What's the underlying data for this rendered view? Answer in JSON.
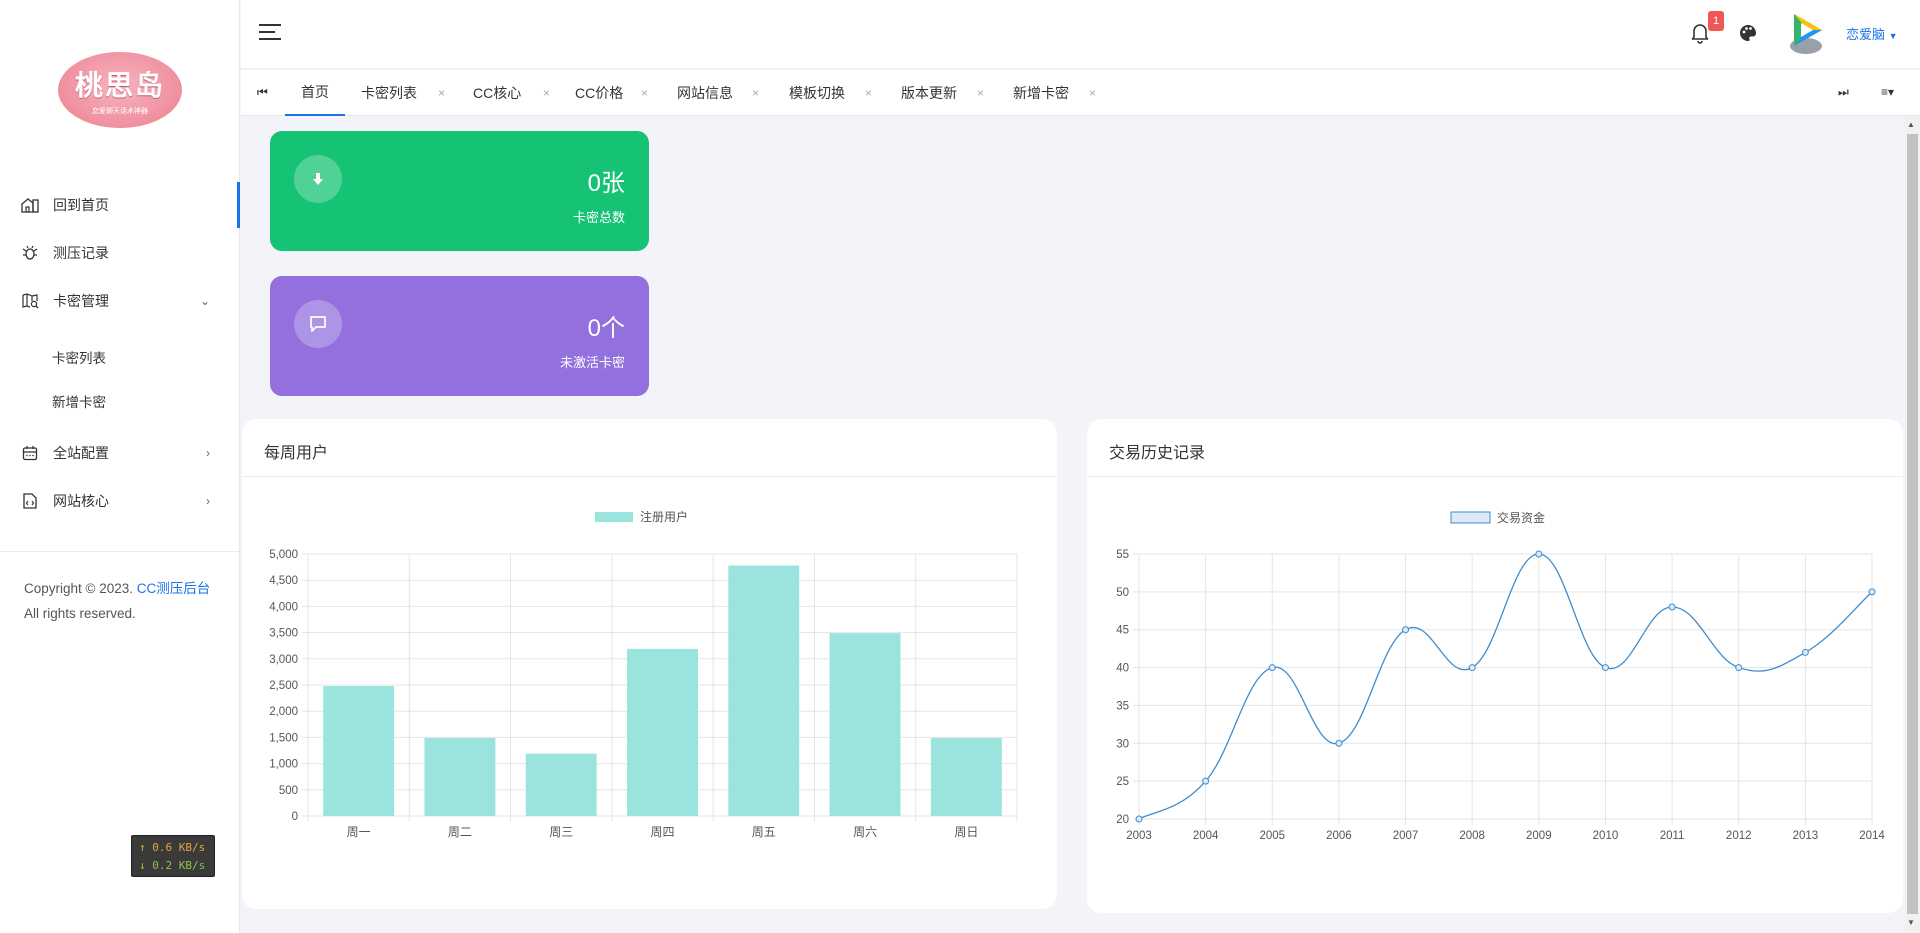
{
  "logo": {
    "title": "桃思岛",
    "subtitle": "恋爱聊天话术神器"
  },
  "sidebar": {
    "items": [
      {
        "label": "回到首页",
        "icon": "home-icon",
        "active": true
      },
      {
        "label": "测压记录",
        "icon": "bug-icon",
        "arrow": ""
      },
      {
        "label": "卡密管理",
        "icon": "map-search-icon",
        "arrow": "⌄"
      },
      {
        "label": "全站配置",
        "icon": "calendar-icon",
        "arrow": "›"
      },
      {
        "label": "网站核心",
        "icon": "file-code-icon",
        "arrow": "›"
      }
    ],
    "subitems": [
      "卡密列表",
      "新增卡密"
    ],
    "copyright": {
      "text": "Copyright © 2023. ",
      "link": "CC测压后台",
      "rights": "All rights reserved."
    },
    "speed": {
      "up": "↑ 0.6 KB/s",
      "down": "↓ 0.2 KB/s"
    }
  },
  "header": {
    "notification_count": "1",
    "username": "恋爱脑"
  },
  "tabs": [
    {
      "label": "首页",
      "active": true
    },
    {
      "label": "卡密列表"
    },
    {
      "label": "CC核心"
    },
    {
      "label": "CC价格"
    },
    {
      "label": "网站信息"
    },
    {
      "label": "模板切换"
    },
    {
      "label": "版本更新"
    },
    {
      "label": "新增卡密"
    }
  ],
  "tab_close": "×",
  "tab_buttons": {
    "first": "⏮",
    "last": "⏭",
    "menu": "≡▾"
  },
  "stats": [
    {
      "value": "0张",
      "label": "卡密总数",
      "color": "#16c375",
      "icon": "download-icon"
    },
    {
      "value": "0个",
      "label": "未激活卡密",
      "color": "#9370dd",
      "icon": "message-icon"
    }
  ],
  "cards": {
    "weekly": "每周用户",
    "history": "交易历史记录"
  },
  "colors": {
    "accent": "#1a73e8",
    "bar": "#9ae4dd",
    "line": "#3f8ccd"
  },
  "chart_data": [
    {
      "type": "bar",
      "title": "",
      "legend": [
        "注册用户"
      ],
      "legend_position": "top",
      "grid": true,
      "categories": [
        "周一",
        "周二",
        "周三",
        "周四",
        "周五",
        "周六",
        "周日"
      ],
      "series": [
        {
          "name": "注册用户",
          "values": [
            2480,
            1490,
            1190,
            3190,
            4780,
            3490,
            1490
          ]
        }
      ],
      "ylim": [
        0,
        5000
      ],
      "yticks": [
        "0",
        "500",
        "1,000",
        "1,500",
        "2,000",
        "2,500",
        "3,000",
        "3,500",
        "4,000",
        "4,500",
        "5,000"
      ]
    },
    {
      "type": "line",
      "title": "",
      "legend": [
        "交易资金"
      ],
      "legend_position": "top",
      "grid": true,
      "x": [
        "2003",
        "2004",
        "2005",
        "2006",
        "2007",
        "2008",
        "2009",
        "2010",
        "2011",
        "2012",
        "2013",
        "2014"
      ],
      "series": [
        {
          "name": "交易资金",
          "values": [
            20,
            25,
            40,
            30,
            45,
            40,
            55,
            40,
            48,
            40,
            42,
            50
          ]
        }
      ],
      "ylim": [
        20,
        55
      ],
      "yticks": [
        "20",
        "25",
        "30",
        "35",
        "40",
        "45",
        "50",
        "55"
      ]
    }
  ]
}
